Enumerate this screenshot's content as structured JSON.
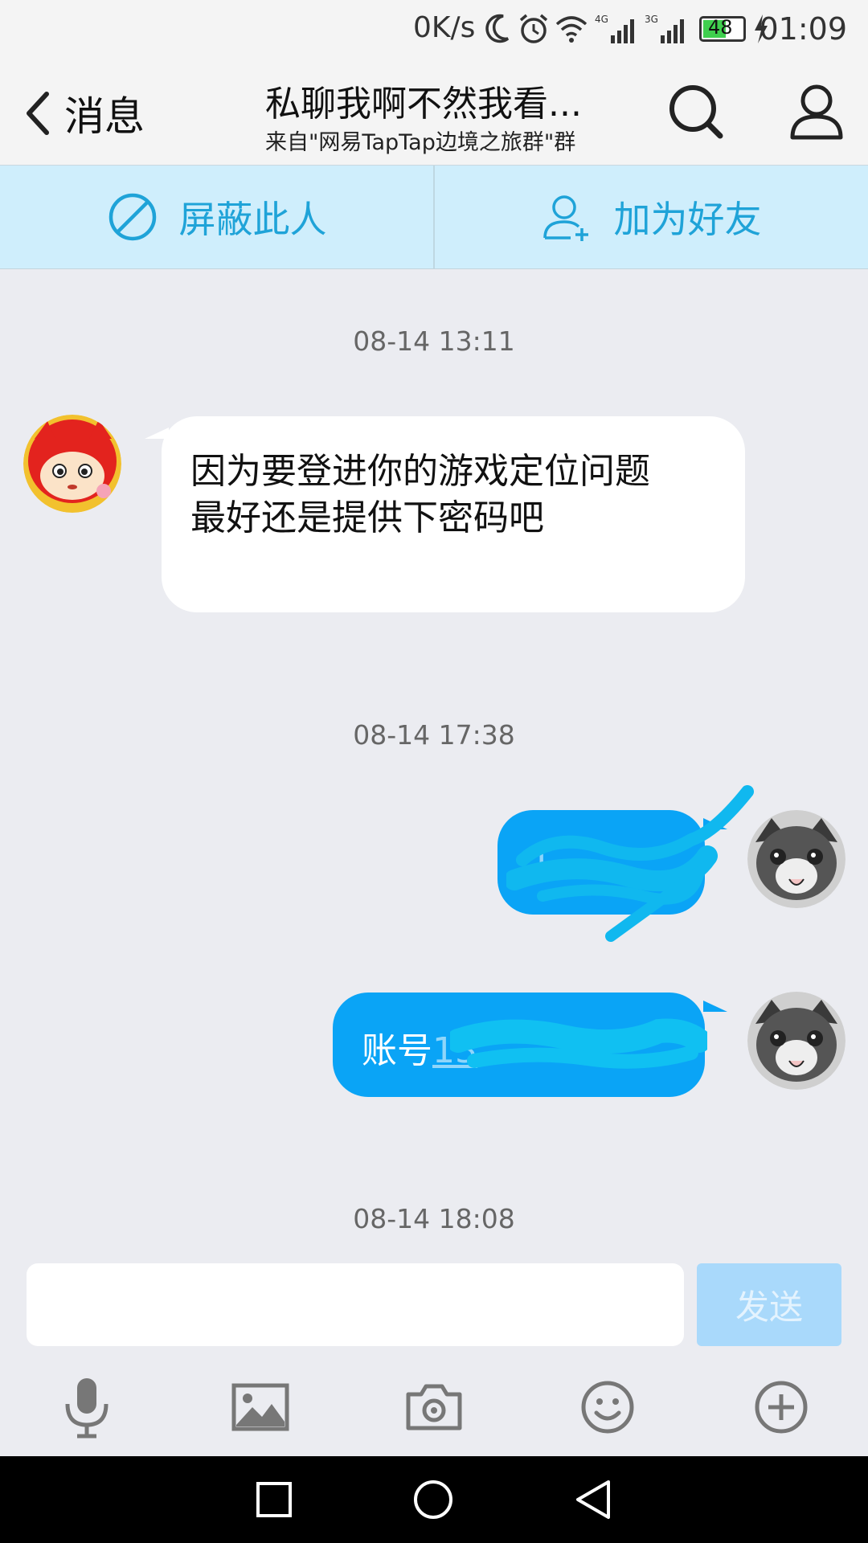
{
  "status_bar": {
    "net_speed": "0K/s",
    "battery": "48",
    "time": "01:09"
  },
  "header": {
    "back_label": "消息",
    "title": "私聊我啊不然我看...",
    "subtitle": "来自\"网易TapTap边境之旅群\"群"
  },
  "actions": {
    "block_label": "屏蔽此人",
    "add_friend_label": "加为好友"
  },
  "messages": [
    {
      "time": "08-14 13:11",
      "side": "left",
      "text": "因为要登进你的游戏定位问题\n最好还是提供下密码吧"
    },
    {
      "time": "08-14 17:38",
      "side": "right",
      "text": "1"
    },
    {
      "side": "right",
      "prefix": "账号",
      "text": "13"
    },
    {
      "time": "08-14 18:08"
    }
  ],
  "input": {
    "placeholder": "",
    "send_label": "发送"
  },
  "colors": {
    "accent": "#0aa4f6",
    "action_bar": "#cfeefc",
    "action_text": "#1fa3d8",
    "send_disabled": "#a9d9fb"
  },
  "toolbar_icons": [
    "mic-icon",
    "image-icon",
    "camera-icon",
    "emoji-icon",
    "plus-icon"
  ],
  "nav_icons": [
    "recents-icon",
    "home-icon",
    "back-nav-icon"
  ]
}
